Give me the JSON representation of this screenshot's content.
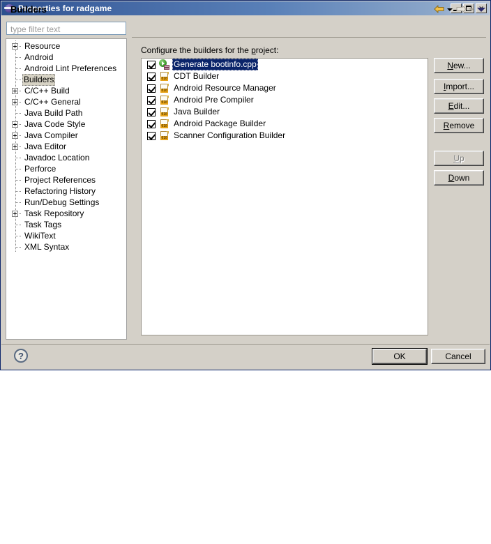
{
  "window": {
    "title": "Properties for radgame",
    "icon": "eclipse-icon",
    "controls": {
      "minimize": "minimize-button",
      "maximize": "maximize-button",
      "close_label": "✕"
    }
  },
  "sidebar": {
    "filter": {
      "value": "",
      "placeholder": "type filter text"
    },
    "items": [
      {
        "label": "Resource",
        "expandable": true,
        "selected": false
      },
      {
        "label": "Android",
        "expandable": false,
        "selected": false
      },
      {
        "label": "Android Lint Preferences",
        "expandable": false,
        "selected": false
      },
      {
        "label": "Builders",
        "expandable": false,
        "selected": true
      },
      {
        "label": "C/C++ Build",
        "expandable": true,
        "selected": false
      },
      {
        "label": "C/C++ General",
        "expandable": true,
        "selected": false
      },
      {
        "label": "Java Build Path",
        "expandable": false,
        "selected": false
      },
      {
        "label": "Java Code Style",
        "expandable": true,
        "selected": false
      },
      {
        "label": "Java Compiler",
        "expandable": true,
        "selected": false
      },
      {
        "label": "Java Editor",
        "expandable": true,
        "selected": false
      },
      {
        "label": "Javadoc Location",
        "expandable": false,
        "selected": false
      },
      {
        "label": "Perforce",
        "expandable": false,
        "selected": false
      },
      {
        "label": "Project References",
        "expandable": false,
        "selected": false
      },
      {
        "label": "Refactoring History",
        "expandable": false,
        "selected": false
      },
      {
        "label": "Run/Debug Settings",
        "expandable": false,
        "selected": false
      },
      {
        "label": "Task Repository",
        "expandable": true,
        "selected": false
      },
      {
        "label": "Task Tags",
        "expandable": false,
        "selected": false
      },
      {
        "label": "WikiText",
        "expandable": false,
        "selected": false
      },
      {
        "label": "XML Syntax",
        "expandable": false,
        "selected": false
      }
    ]
  },
  "page": {
    "title": "Builders",
    "description": "Configure the builders for the project:",
    "nav": {
      "back_icon": "back-arrow-icon",
      "back_enabled": true,
      "forward_icon": "forward-arrow-icon",
      "forward_enabled": false,
      "menu_icon": "view-menu-caret-icon"
    },
    "builders": [
      {
        "label": "Generate bootinfo.cpp",
        "checked": true,
        "selected": true,
        "icon": "run-program-icon",
        "icon_text": ""
      },
      {
        "label": "CDT Builder",
        "checked": true,
        "selected": false,
        "icon": "builder-doc-icon",
        "icon_text": "010"
      },
      {
        "label": "Android Resource Manager",
        "checked": true,
        "selected": false,
        "icon": "builder-doc-icon",
        "icon_text": "010"
      },
      {
        "label": "Android Pre Compiler",
        "checked": true,
        "selected": false,
        "icon": "builder-doc-icon",
        "icon_text": "010"
      },
      {
        "label": "Java Builder",
        "checked": true,
        "selected": false,
        "icon": "builder-doc-icon",
        "icon_text": "010"
      },
      {
        "label": "Android Package Builder",
        "checked": true,
        "selected": false,
        "icon": "builder-doc-icon",
        "icon_text": "010"
      },
      {
        "label": "Scanner Configuration Builder",
        "checked": true,
        "selected": false,
        "icon": "builder-doc-icon",
        "icon_text": "010"
      }
    ],
    "side_buttons": [
      {
        "label": "New...",
        "mnemonic": "N",
        "enabled": true
      },
      {
        "label": "Import...",
        "mnemonic": "I",
        "enabled": true
      },
      {
        "label": "Edit...",
        "mnemonic": "E",
        "enabled": true
      },
      {
        "label": "Remove",
        "mnemonic": "R",
        "enabled": true
      },
      {
        "label": "Up",
        "mnemonic": "U",
        "enabled": false
      },
      {
        "label": "Down",
        "mnemonic": "D",
        "enabled": true
      }
    ]
  },
  "footer": {
    "help_label": "?",
    "ok_label": "OK",
    "cancel_label": "Cancel"
  },
  "colors": {
    "dialog_face": "#d4d0c8",
    "title_gradient_start": "#2c4f8e",
    "selection_blue": "#0a246a",
    "tree_selection": "#d6d2c4"
  }
}
